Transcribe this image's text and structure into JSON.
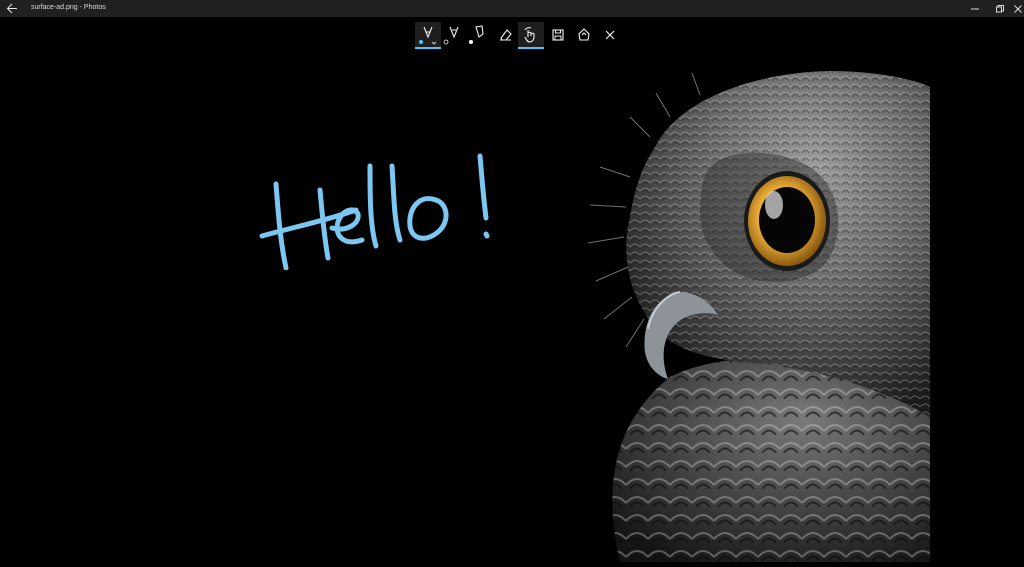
{
  "window": {
    "title": "surface-ad.png - Photos"
  },
  "toolbar": {
    "tools": [
      {
        "name": "Ballpoint pen",
        "icon": "ballpoint-pen-icon",
        "selected": true,
        "color_swatch": "#4cc2ff"
      },
      {
        "name": "Pencil",
        "icon": "pencil-icon",
        "selected": false,
        "color_swatch": "#000000"
      },
      {
        "name": "Calligraphy pen",
        "icon": "calligraphy-pen-icon",
        "selected": false,
        "color_swatch": "#ffffff"
      },
      {
        "name": "Eraser",
        "icon": "eraser-icon",
        "selected": false
      },
      {
        "name": "Touch writing",
        "icon": "touch-writing-icon",
        "selected": true
      },
      {
        "name": "Save a copy",
        "icon": "save-copy-icon",
        "selected": false
      },
      {
        "name": "Share",
        "icon": "share-icon",
        "selected": false
      },
      {
        "name": "Close",
        "icon": "close-icon",
        "selected": false
      }
    ]
  },
  "canvas": {
    "handwriting": "Hello!",
    "ink_color": "#7cc7f2"
  }
}
